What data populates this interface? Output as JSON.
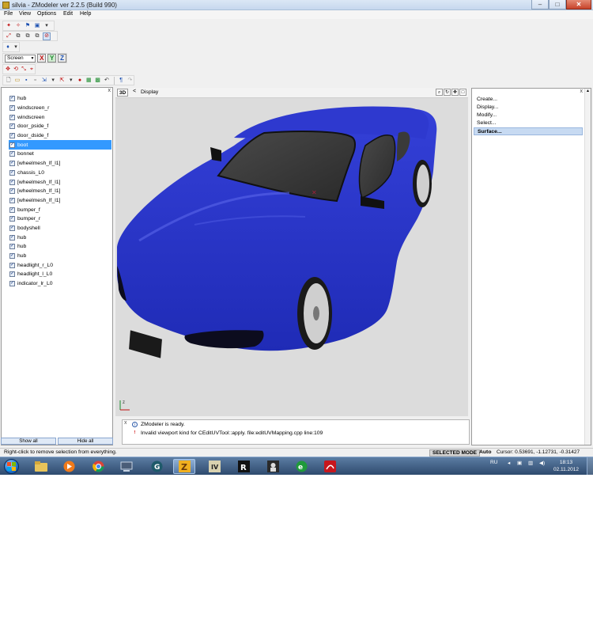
{
  "window": {
    "title": "silvia - ZModeler ver 2.2.5 (Build 990)",
    "min_glyph": "–",
    "max_glyph": "□",
    "close_glyph": "✕"
  },
  "menubar": {
    "items": [
      "File",
      "View",
      "Options",
      "Edit",
      "Help"
    ]
  },
  "toolbars": {
    "coordinate_system": "Screen",
    "axis_x": "X",
    "axis_y": "Y",
    "axis_z": "Z"
  },
  "left_panel": {
    "close_glyph": "x",
    "objects": [
      {
        "name": "hub",
        "checked": true
      },
      {
        "name": "windscreen_r",
        "checked": true
      },
      {
        "name": "windscreen",
        "checked": true
      },
      {
        "name": "door_pside_f",
        "checked": true
      },
      {
        "name": "door_dside_f",
        "checked": true
      },
      {
        "name": "boot",
        "checked": true,
        "selected": true
      },
      {
        "name": "bonnet",
        "checked": true
      },
      {
        "name": "[wheelmesh_lf_l1]",
        "checked": true
      },
      {
        "name": "chassis_L0",
        "checked": true
      },
      {
        "name": "[wheelmesh_lf_l1]",
        "checked": true
      },
      {
        "name": "[wheelmesh_lf_l1]",
        "checked": true
      },
      {
        "name": "[wheelmesh_lf_l1]",
        "checked": true
      },
      {
        "name": "bumper_f",
        "checked": true
      },
      {
        "name": "bumper_r",
        "checked": true
      },
      {
        "name": "bodyshell",
        "checked": true
      },
      {
        "name": "hub",
        "checked": true
      },
      {
        "name": "hub",
        "checked": true
      },
      {
        "name": "hub",
        "checked": true
      },
      {
        "name": "headlight_r_L0",
        "checked": true
      },
      {
        "name": "headlight_l_L0",
        "checked": true
      },
      {
        "name": "indicator_lr_L0",
        "checked": true
      }
    ],
    "show_all": "Show all",
    "hide_all": "Hide all"
  },
  "viewport": {
    "view_label": "3D",
    "back_glyph": "<",
    "mode_label": "Display",
    "model_color": "#2a35c9",
    "background_color": "#dcdcdc"
  },
  "log": {
    "close_glyph": "x",
    "lines": [
      {
        "type": "info",
        "text": "ZModeler is ready."
      },
      {
        "type": "error",
        "text": "Invalid viewport kind for CEditUVTool::apply.  file:editUVMapping.cpp line:109"
      }
    ]
  },
  "right_panel": {
    "close_glyph": "x",
    "commands": [
      "Create...",
      "Display...",
      "Modify...",
      "Select...",
      "Surface..."
    ],
    "active_command": "Surface..."
  },
  "statusbar": {
    "hint": "Right-click to remove selection from everything.",
    "mode": "SELECTED MODE",
    "auto": "Auto",
    "cursor": "Cursor: 0.53691, -1.12731, -0.31427"
  },
  "taskbar": {
    "language": "RU",
    "time": "18:13",
    "date": "02.11.2012"
  }
}
